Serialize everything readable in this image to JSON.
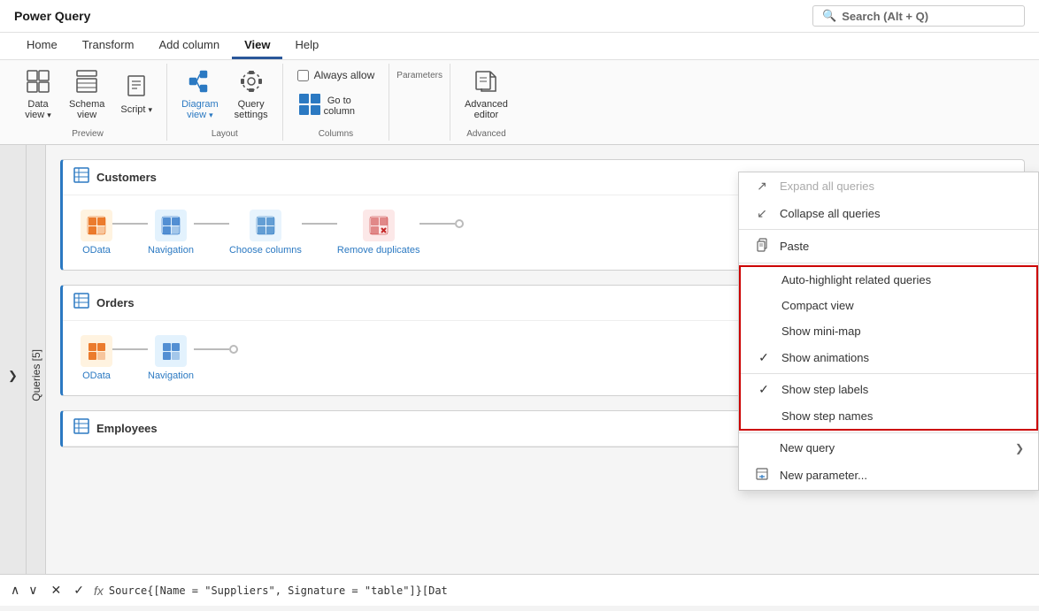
{
  "titleBar": {
    "appName": "Power Query",
    "search": {
      "placeholder": "Search (Alt + Q)",
      "icon": "🔍"
    }
  },
  "menuBar": {
    "items": [
      {
        "label": "Home",
        "active": false
      },
      {
        "label": "Transform",
        "active": false
      },
      {
        "label": "Add column",
        "active": false
      },
      {
        "label": "View",
        "active": true
      },
      {
        "label": "Help",
        "active": false
      }
    ]
  },
  "ribbon": {
    "groups": [
      {
        "label": "Preview",
        "buttons": [
          {
            "id": "data-view",
            "icon": "⊞",
            "label": "Data\nview ▾",
            "type": "split"
          },
          {
            "id": "schema-view",
            "icon": "🗂",
            "label": "Schema\nview"
          },
          {
            "id": "script",
            "icon": "📄",
            "label": "Script ▾",
            "type": "split"
          }
        ]
      },
      {
        "label": "Layout",
        "buttons": [
          {
            "id": "diagram-view",
            "icon": "⬡",
            "label": "Diagram\nview ▾",
            "type": "split",
            "color": "#2b79c2"
          },
          {
            "id": "query-settings",
            "icon": "⚙",
            "label": "Query\nsettings"
          }
        ]
      },
      {
        "label": "Columns",
        "buttons": [
          {
            "id": "go-to-column",
            "icon": "⊞",
            "label": "Go to\ncolumn",
            "color": "#2b79c2"
          }
        ],
        "checkbox": {
          "label": "Always allow",
          "checked": false
        }
      },
      {
        "label": "Parameters",
        "buttons": []
      },
      {
        "label": "Advanced",
        "buttons": [
          {
            "id": "advanced-editor",
            "icon": "📃",
            "label": "Advanced\neditor"
          }
        ]
      }
    ]
  },
  "sidebar": {
    "label": "Queries [5]",
    "collapseIcon": "❯"
  },
  "queries": [
    {
      "name": "Customers",
      "steps": [
        {
          "id": "odata1",
          "icon": "orange",
          "label": "OData"
        },
        {
          "id": "nav1",
          "icon": "blue-grid",
          "label": "Navigation"
        },
        {
          "id": "choose1",
          "icon": "blue-grid2",
          "label": "Choose columns"
        },
        {
          "id": "remove1",
          "icon": "red-x",
          "label": "Remove duplicates"
        }
      ]
    },
    {
      "name": "Orders",
      "steps": [
        {
          "id": "odata2",
          "icon": "orange",
          "label": "OData"
        },
        {
          "id": "nav2",
          "icon": "blue-grid",
          "label": "Navigation"
        }
      ]
    },
    {
      "name": "Employees",
      "steps": []
    }
  ],
  "formulaBar": {
    "navUp": "∧",
    "navDown": "∨",
    "cancelBtn": "✕",
    "confirmBtn": "✓",
    "fxLabel": "fx",
    "formula": "Source{[Name = \"Suppliers\", Signature = \"table\"]}[Dat"
  },
  "contextMenu": {
    "items": [
      {
        "id": "expand-all",
        "icon": "↗",
        "label": "Expand all queries",
        "disabled": true,
        "check": ""
      },
      {
        "id": "collapse-all",
        "icon": "↙",
        "label": "Collapse all queries",
        "disabled": false,
        "check": ""
      },
      {
        "divider": true
      },
      {
        "id": "paste",
        "icon": "📋",
        "label": "Paste",
        "disabled": false,
        "check": ""
      },
      {
        "divider": true
      },
      {
        "id": "auto-highlight",
        "label": "Auto-highlight related queries",
        "disabled": false,
        "check": "",
        "highlighted": true
      },
      {
        "id": "compact-view",
        "label": "Compact view",
        "disabled": false,
        "check": "",
        "highlighted": true
      },
      {
        "id": "show-minimap",
        "label": "Show mini-map",
        "disabled": false,
        "check": "",
        "highlighted": true
      },
      {
        "id": "show-animations",
        "label": "Show animations",
        "disabled": false,
        "check": "✓",
        "highlighted": true
      },
      {
        "divider": true,
        "highlighted": true
      },
      {
        "id": "show-step-labels",
        "label": "Show step labels",
        "disabled": false,
        "check": "✓",
        "highlighted": true
      },
      {
        "id": "show-step-names",
        "label": "Show step names",
        "disabled": false,
        "check": "",
        "highlighted": true
      },
      {
        "divider": true
      },
      {
        "id": "new-query",
        "label": "New query",
        "disabled": false,
        "check": "",
        "arrow": "❯"
      },
      {
        "id": "new-parameter",
        "icon": "🔧",
        "label": "New parameter...",
        "disabled": false,
        "check": ""
      }
    ]
  }
}
